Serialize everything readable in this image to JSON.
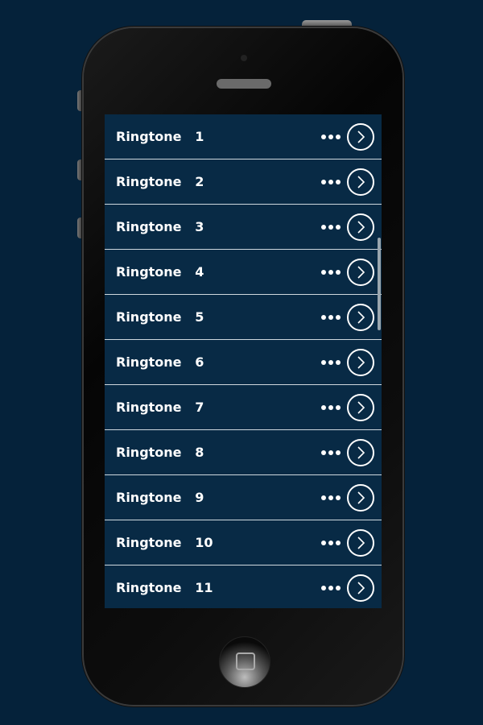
{
  "colors": {
    "background": "#05223a",
    "row": "#082a45",
    "separator": "#cfd8de",
    "text": "#ffffff"
  },
  "list": {
    "items": [
      {
        "label": "Ringtone   1",
        "more_icon": "more-horizontal-icon",
        "action_icon": "chevron-right-circle-icon"
      },
      {
        "label": "Ringtone   2",
        "more_icon": "more-horizontal-icon",
        "action_icon": "chevron-right-circle-icon"
      },
      {
        "label": "Ringtone   3",
        "more_icon": "more-horizontal-icon",
        "action_icon": "chevron-right-circle-icon"
      },
      {
        "label": "Ringtone   4",
        "more_icon": "more-horizontal-icon",
        "action_icon": "chevron-right-circle-icon"
      },
      {
        "label": "Ringtone   5",
        "more_icon": "more-horizontal-icon",
        "action_icon": "chevron-right-circle-icon"
      },
      {
        "label": "Ringtone   6",
        "more_icon": "more-horizontal-icon",
        "action_icon": "chevron-right-circle-icon"
      },
      {
        "label": "Ringtone   7",
        "more_icon": "more-horizontal-icon",
        "action_icon": "chevron-right-circle-icon"
      },
      {
        "label": "Ringtone   8",
        "more_icon": "more-horizontal-icon",
        "action_icon": "chevron-right-circle-icon"
      },
      {
        "label": "Ringtone   9",
        "more_icon": "more-horizontal-icon",
        "action_icon": "chevron-right-circle-icon"
      },
      {
        "label": "Ringtone   10",
        "more_icon": "more-horizontal-icon",
        "action_icon": "chevron-right-circle-icon"
      },
      {
        "label": "Ringtone   11",
        "more_icon": "more-horizontal-icon",
        "action_icon": "chevron-right-circle-icon"
      }
    ]
  }
}
